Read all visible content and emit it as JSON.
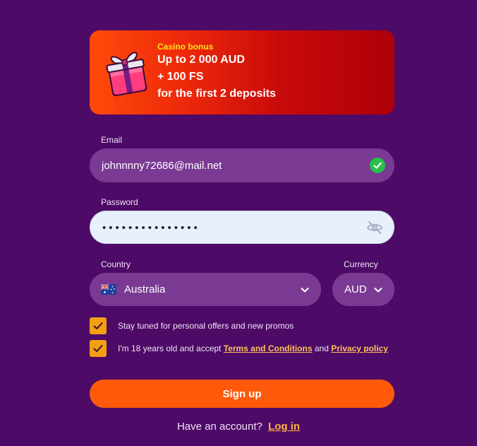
{
  "banner": {
    "kicker": "Casino bonus",
    "line1": "Up to 2 000 AUD",
    "line2": "+ 100 FS",
    "line3": "for the first 2 deposits"
  },
  "email": {
    "label": "Email",
    "value": "johnnnny72686@mail.net"
  },
  "password": {
    "label": "Password",
    "value": "•••••••••••••••"
  },
  "country": {
    "label": "Country",
    "value": "Australia"
  },
  "currency": {
    "label": "Currency",
    "value": "AUD"
  },
  "checkboxes": {
    "offers": {
      "text": "Stay tuned for personal offers and new promos",
      "checked": true
    },
    "terms": {
      "prefix": "I'm 18 years old and accept",
      "terms_link": "Terms and Conditions",
      "and": "and",
      "privacy_link": "Privacy policy",
      "checked": true
    }
  },
  "signup_label": "Sign up",
  "login": {
    "prompt": "Have an account?",
    "link": "Log in"
  },
  "colors": {
    "background": "#4d0a67",
    "input": "#7a3a93",
    "accent": "#ff5a0a",
    "checkbox": "#f2a011",
    "link": "#ffb33d"
  }
}
